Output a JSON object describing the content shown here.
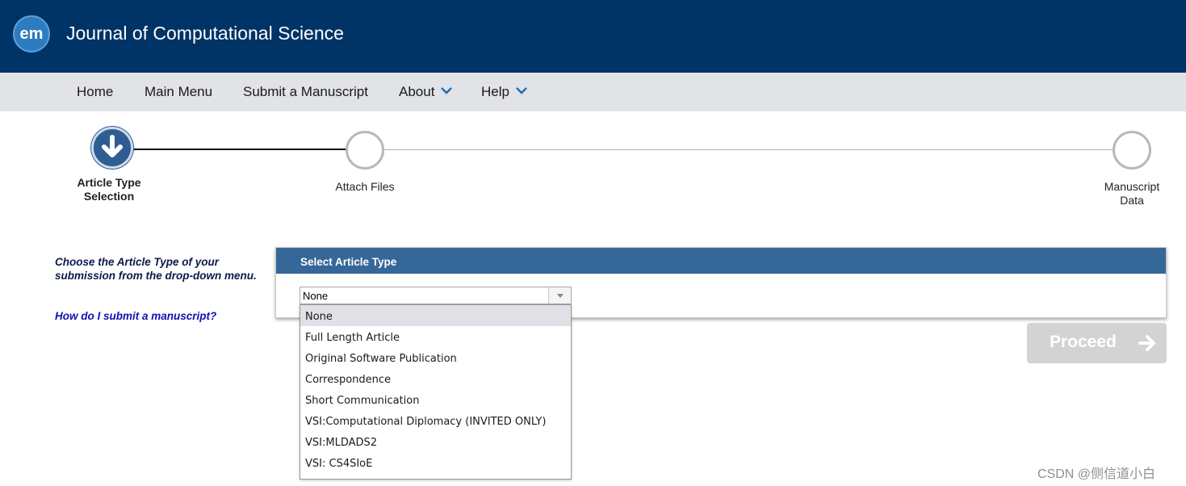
{
  "header": {
    "logo_text": "em",
    "journal_title": "Journal of Computational Science",
    "bg_color": "#003366"
  },
  "nav": {
    "items": [
      {
        "label": "Home"
      },
      {
        "label": "Main Menu"
      },
      {
        "label": "Submit a Manuscript"
      },
      {
        "label": "About",
        "has_dropdown": true
      },
      {
        "label": "Help",
        "has_dropdown": true
      }
    ]
  },
  "stepper": {
    "steps": [
      {
        "label_line1": "Article Type",
        "label_line2": "Selection",
        "state": "current",
        "icon": "arrow-down-icon"
      },
      {
        "label_line1": "Attach Files",
        "label_line2": "",
        "state": "pending"
      },
      {
        "label_line1": "Manuscript",
        "label_line2": "Data",
        "state": "pending"
      }
    ]
  },
  "instructions": {
    "text": "Choose the Article Type of your submission from the drop-down menu.",
    "help_link": "How do I submit a manuscript?"
  },
  "panel": {
    "title": "Select Article Type",
    "select": {
      "value": "None",
      "options": [
        "None",
        "Full Length Article",
        "Original Software Publication",
        "Correspondence",
        "Short Communication",
        "VSI:Computational Diplomacy (INVITED ONLY)",
        "VSI:MLDADS2",
        "VSI: CS4SIoE"
      ],
      "highlighted_index": 0
    }
  },
  "actions": {
    "proceed_label": "Proceed",
    "proceed_enabled": false
  },
  "watermark": "CSDN @侧信道小白",
  "colors": {
    "accent": "#356798",
    "nav_bg": "#e1e3e6",
    "link": "#1010b0"
  }
}
